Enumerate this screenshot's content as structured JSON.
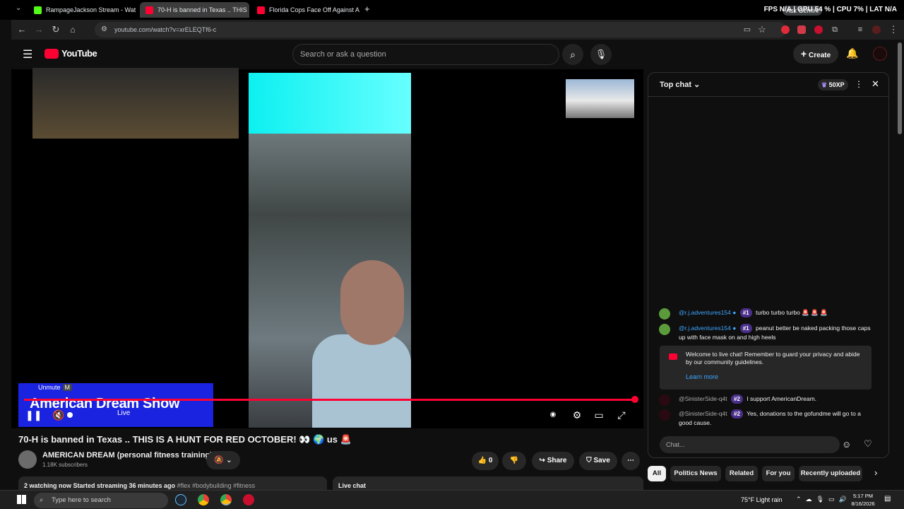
{
  "browser": {
    "tabs": [
      {
        "title": "RampageJackson Stream - Wat",
        "favicon_color": "#53fc18",
        "active": false
      },
      {
        "title": "70-H is banned in Texas .. THIS",
        "favicon_color": "#ff0033",
        "active": true
      },
      {
        "title": "Florida Cops Face Off Against A",
        "favicon_color": "#ff0033",
        "active": false
      }
    ],
    "new_tab_label": "+",
    "url": "youtube.com/watch?v=xrELEQTf6-c",
    "perf_overlay": "FPS N/A | GPU 54 % | CPU 7% | LAT N/A",
    "ask_gemini": "Ask Gemini"
  },
  "youtube": {
    "logo_text": "YouTube",
    "search_placeholder": "Search or ask a question",
    "create_label": "Create"
  },
  "player": {
    "banner_text": "American Dream Show",
    "unmute_label": "Unmute",
    "unmute_key": "M",
    "live_label": "Live",
    "progress_fraction": 1.0
  },
  "video": {
    "title": "70-H is banned in Texas .. THIS IS A HUNT FOR RED OCTOBER! 👀 🌍 us 🚨",
    "channel_name": "AMERICAN DREAM (personal fitness training)",
    "subscribers": "1.18K subscribers",
    "like_count": "0",
    "share_label": "Share",
    "save_label": "Save",
    "description_stats": "2 watching now  Started streaming 36 minutes ago",
    "description_tags": "#flex #bodybuilding #fitness",
    "live_chat_label": "Live chat"
  },
  "chat": {
    "mode_label": "Top chat",
    "xp_badge": "50XP",
    "messages": [
      {
        "author": "@r.j.adventures154",
        "rank": "#1",
        "text": "turbo turbo turbo 🚨 🚨 🚨",
        "avatar_color": "#5b9b3b"
      },
      {
        "author": "@r.j.adventures154",
        "rank": "#1",
        "text": "peanut better be naked packing those caps up with face mask on and high heels",
        "avatar_color": "#5b9b3b"
      },
      {
        "author": "@SinisterSide-q4t",
        "rank": "#2",
        "text": "I support AmericanDream.",
        "avatar_color": "#2a0a12"
      },
      {
        "author": "@SinisterSide-q4t",
        "rank": "#2",
        "text": "Yes, donations to the gofundme will go to a good cause.",
        "avatar_color": "#2a0a12"
      }
    ],
    "welcome_text": "Welcome to live chat! Remember to guard your privacy and abide by our community guidelines.",
    "learn_more": "Learn more",
    "input_placeholder": "Chat..."
  },
  "chips": [
    "All",
    "Politics News",
    "Related",
    "For you",
    "Recently uploaded"
  ],
  "taskbar": {
    "search_placeholder": "Type here to search",
    "weather": "75°F  Light rain",
    "time": "5:17 PM",
    "date": "8/16/2026"
  }
}
